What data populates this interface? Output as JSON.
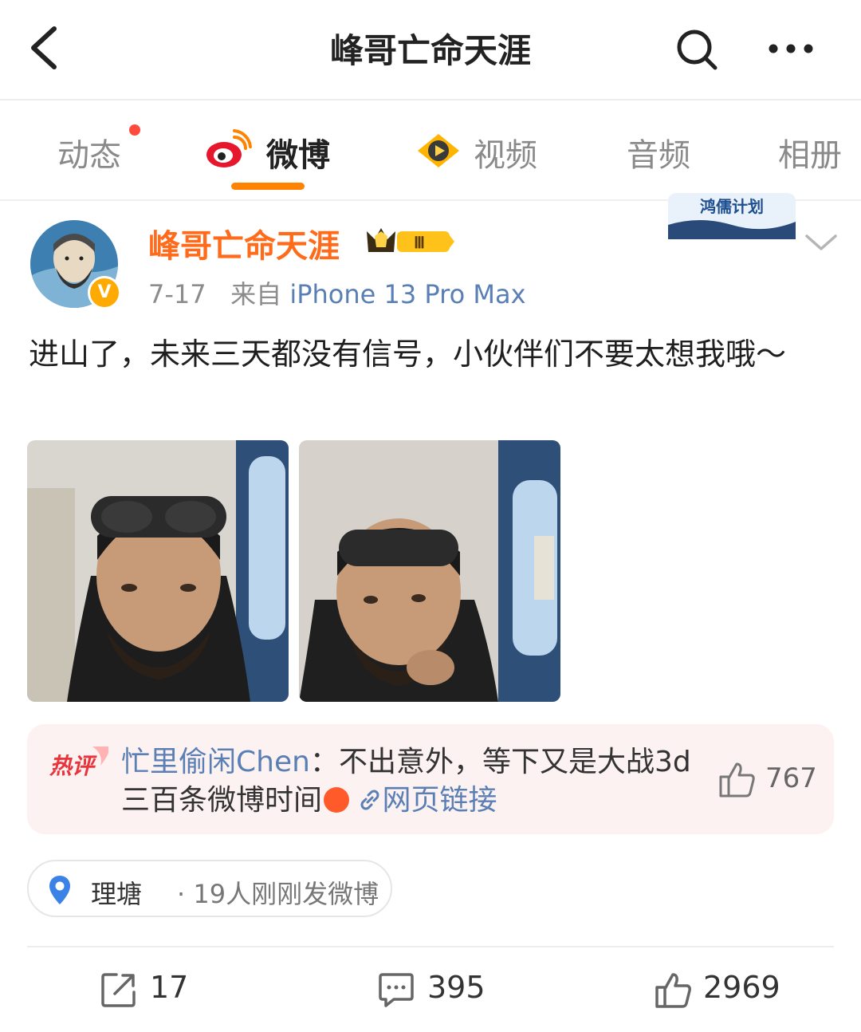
{
  "header": {
    "title": "峰哥亡命天涯",
    "back_icon": "chevron-left-icon",
    "search_icon": "search-icon",
    "more_icon": "more-dots-icon"
  },
  "tabs": [
    {
      "label": "动态",
      "has_dot": true
    },
    {
      "label": "微博",
      "active": true,
      "icon": "weibo-logo-icon"
    },
    {
      "label": "视频",
      "icon": "video-play-icon"
    },
    {
      "label": "音频"
    },
    {
      "label": "相册"
    }
  ],
  "post": {
    "author": "峰哥亡命天涯",
    "verified": "V",
    "vip_level": "Ⅲ",
    "date": "7-17",
    "source_prefix": "来自",
    "source": "iPhone 13 Pro Max",
    "text": "进山了，未来三天都没有信号，小伙伴们不要太想我哦～",
    "photos": [
      "selfie-photo-1",
      "selfie-photo-2"
    ],
    "promo_banner_text": "鸿儒计划"
  },
  "hot_comment": {
    "tag": "热评",
    "commenter": "忙里偷闲Chen",
    "separator": "：",
    "text": "不出意外，等下又是大战3d三百条微博时间",
    "link_text": "网页链接",
    "likes": "767"
  },
  "location": {
    "place": "理塘",
    "extra": "· 19人刚刚发微博"
  },
  "actions": {
    "repost": "17",
    "comments": "395",
    "likes": "2969"
  },
  "colors": {
    "accent_orange": "#ff8200",
    "author_orange": "#ff6b1a",
    "link_blue": "#5a7fb5",
    "hot_bg": "#fdf2f2"
  }
}
